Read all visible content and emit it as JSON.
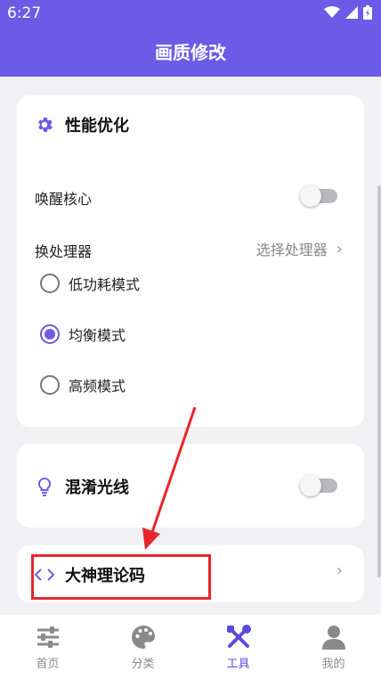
{
  "status_bar": {
    "time": "6:27"
  },
  "header": {
    "title": "画质修改"
  },
  "performance": {
    "title": "性能优化",
    "wake_core_label": "唤醒核心",
    "processor_label": "换处理器",
    "processor_value": "选择处理器",
    "modes": [
      {
        "label": "低功耗模式",
        "selected": false
      },
      {
        "label": "均衡模式",
        "selected": true
      },
      {
        "label": "高频模式",
        "selected": false
      }
    ]
  },
  "confuse_light": {
    "title": "混淆光线"
  },
  "god_code": {
    "title": "大神理论码"
  },
  "tabs": [
    {
      "label": "首页",
      "icon": "sliders-icon"
    },
    {
      "label": "分类",
      "icon": "palette-icon"
    },
    {
      "label": "工具",
      "icon": "tools-icon",
      "active": true
    },
    {
      "label": "我的",
      "icon": "user-icon"
    }
  ],
  "colors": {
    "accent": "#6b5ce7",
    "annotation": "#e8262b"
  }
}
